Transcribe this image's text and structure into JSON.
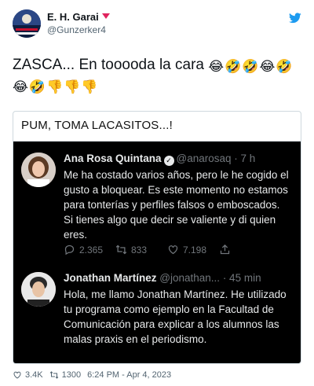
{
  "tweet": {
    "author_name": "E. H. Garai",
    "author_handle": "@Gunzerker4",
    "text": "ZASCA... En tooooda la cara",
    "emojis": [
      "😂",
      "🤣",
      "🤣",
      "😂",
      "🤣",
      "😂",
      "🤣",
      "👎",
      "👎",
      "👎"
    ]
  },
  "embed": {
    "heading": "PUM, TOMA LACASITOS...!",
    "tweet1": {
      "name": "Ana Rosa Quintana",
      "handle": "@anarosaq",
      "time": "· 7 h",
      "body": "Me ha costado varios años, pero  le he cogido el gusto a bloquear. Es este momento no estamos para tonterías y perfiles falsos o emboscados. Si tienes algo que decir se valiente y di quien eres.",
      "replies": "2.365",
      "retweets": "833",
      "likes": "7.198"
    },
    "tweet2": {
      "name": "Jonathan Martínez",
      "handle": "@jonathan...",
      "time": "· 45 min",
      "body": "Hola, me llamo Jonathan Martínez. He utilizado tu programa como ejemplo en la Facultad de Comunicación para explicar a los alumnos las malas praxis en el periodismo."
    }
  },
  "footer": {
    "likes": "3.4K",
    "retweets": "1300",
    "timestamp": "6:24 PM - Apr 4, 2023"
  },
  "colors": {
    "brand_blue": "#1d9bf0",
    "dark_bg": "#000000",
    "muted": "#536471"
  },
  "icons": [
    "twitter-bird-icon",
    "verified-icon",
    "reply-icon",
    "retweet-icon",
    "like-icon",
    "share-icon"
  ]
}
